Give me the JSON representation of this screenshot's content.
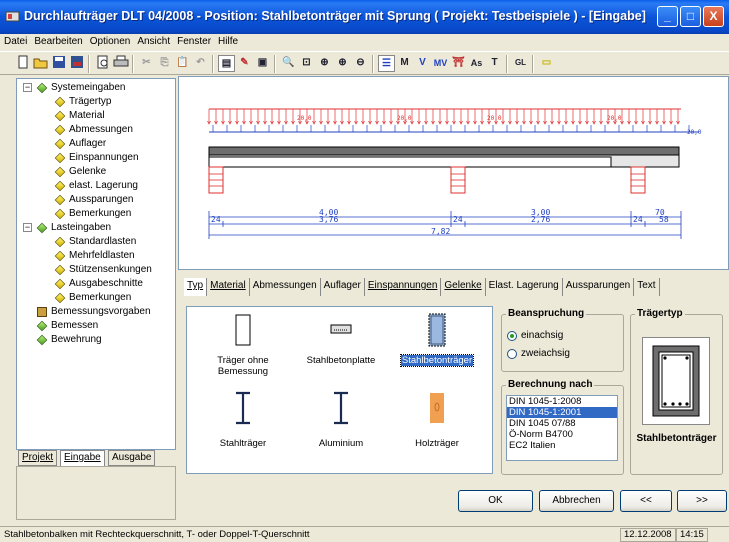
{
  "window": {
    "title": "Durchlaufträger DLT 04/2008 - Position: Stahlbetonträger mit Sprung ( Projekt: Testbeispiele ) - [Eingabe]",
    "min_label": "_",
    "max_label": "□",
    "close_label": "X"
  },
  "menu": [
    "Datei",
    "Bearbeiten",
    "Optionen",
    "Ansicht",
    "Fenster",
    "Hilfe"
  ],
  "toolbar": {
    "buttons": [
      "M",
      "V",
      "MV",
      "As",
      "T",
      "GL"
    ]
  },
  "tree": {
    "system": "Systemeingaben",
    "system_items": [
      "Trägertyp",
      "Material",
      "Abmessungen",
      "Auflager",
      "Einspannungen",
      "Gelenke",
      "elast. Lagerung",
      "Aussparungen",
      "Bemerkungen"
    ],
    "loads": "Lasteingaben",
    "load_items": [
      "Standardlasten",
      "Mehrfeldlasten",
      "Stützensenkungen",
      "Ausgabeschnitte",
      "Bemerkungen"
    ],
    "rest": [
      "Bemessungsvorgaben",
      "Bemessen",
      "Bewehrung"
    ]
  },
  "side_tabs": [
    "Projekt",
    "Eingabe",
    "Ausgabe"
  ],
  "drawing": {
    "load_labels": [
      "20,0",
      "20,0",
      "20,0",
      "20,0",
      "20,0"
    ],
    "dim_top": [
      "4,00",
      "3,00",
      "70"
    ],
    "dim_mid": [
      "24",
      "3,76",
      "24",
      "2,76",
      "24",
      "58"
    ],
    "dim_total": "7,82"
  },
  "tabs": [
    "Typ",
    "Material",
    "Abmessungen",
    "Auflager",
    "Einspannungen",
    "Gelenke",
    "Elast. Lagerung",
    "Aussparungen",
    "Text"
  ],
  "types": [
    {
      "label": "Träger ohne Bemessung"
    },
    {
      "label": "Stahlbetonplatte"
    },
    {
      "label": "Stahlbetonträger"
    },
    {
      "label": "Stahlträger"
    },
    {
      "label": "Aluminium"
    },
    {
      "label": "Holzträger"
    }
  ],
  "beanspruchung": {
    "title": "Beanspruchung",
    "options": [
      "einachsig",
      "zweiachsig"
    ]
  },
  "berechnung": {
    "title": "Berechnung nach",
    "items": [
      "DIN 1045-1:2008",
      "DIN 1045-1:2001",
      "DIN 1045 07/88",
      "Ö-Norm B4700",
      "EC2 Italien"
    ],
    "selected": 1
  },
  "traegertyp": {
    "title": "Trägertyp",
    "label": "Stahlbetonträger"
  },
  "buttons": {
    "ok": "OK",
    "cancel": "Abbrechen",
    "prev": "<<",
    "next": ">>"
  },
  "status": {
    "text": "Stahlbetonbalken mit Rechteckquerschnitt, T- oder Doppel-T-Querschnitt",
    "date": "12.12.2008",
    "time": "14:15"
  },
  "colors": {
    "title_blue": "#0b55d8",
    "load_red": "#e03030",
    "load_blue": "#2040c0",
    "selection": "#316ac5"
  }
}
